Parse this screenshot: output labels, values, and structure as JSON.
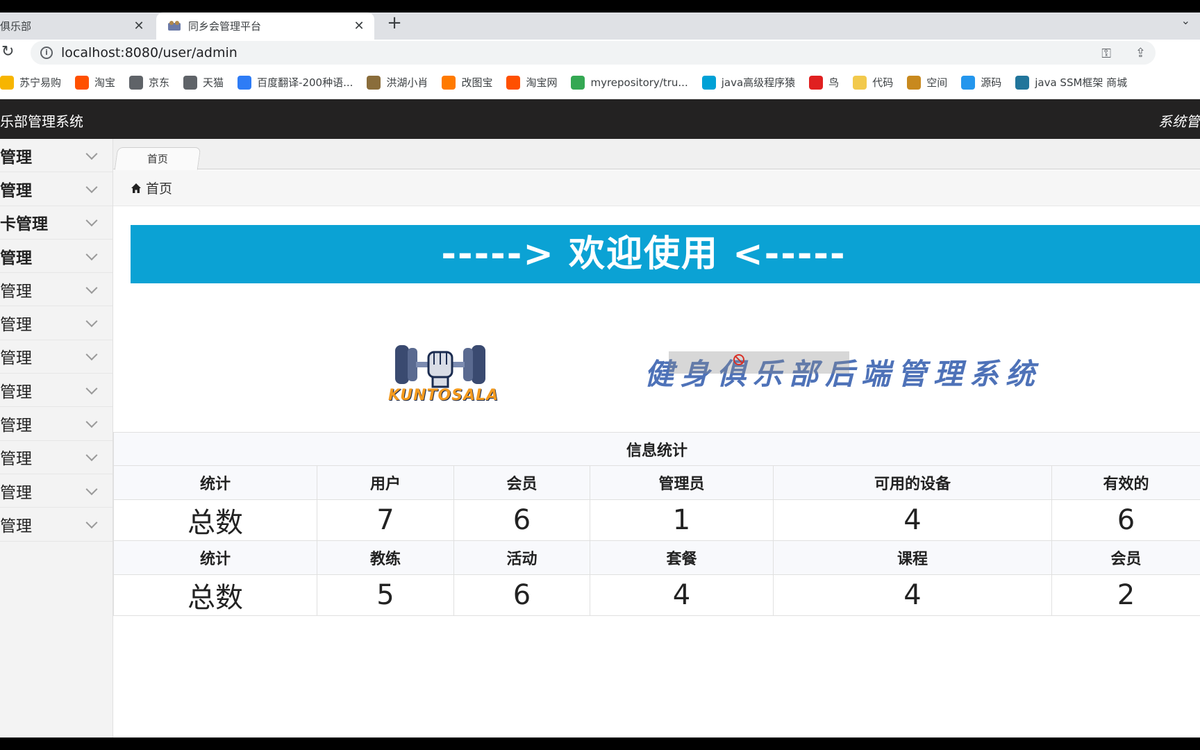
{
  "browser": {
    "tabs": [
      {
        "label": "俱乐部",
        "active": false
      },
      {
        "label": "同乡会管理平台",
        "active": true
      }
    ],
    "new_tab": "+",
    "url": "localhost:8080/user/admin",
    "bookmarks": [
      {
        "label": "苏宁易购",
        "icon": "suning-icon",
        "color": "#f7b500"
      },
      {
        "label": "淘宝",
        "icon": "taobao-icon",
        "color": "#ff5000"
      },
      {
        "label": "京东",
        "icon": "globe-icon",
        "color": "#5f6368"
      },
      {
        "label": "天猫",
        "icon": "globe-icon",
        "color": "#5f6368"
      },
      {
        "label": "百度翻译-200种语...",
        "icon": "baidu-translate-icon",
        "color": "#2e7cf6"
      },
      {
        "label": "洪湖小肖",
        "icon": "bird-icon",
        "color": "#8a6d3b"
      },
      {
        "label": "改图宝",
        "icon": "gaitubao-icon",
        "color": "#ff7a00"
      },
      {
        "label": "淘宝网",
        "icon": "taobao-icon",
        "color": "#ff5000"
      },
      {
        "label": "myrepository/tru...",
        "icon": "chrome-icon",
        "color": "#34a853"
      },
      {
        "label": "java高级程序猿",
        "icon": "bilibili-icon",
        "color": "#00a1d6"
      },
      {
        "label": "鸟",
        "icon": "bird-icon",
        "color": "#e02020"
      },
      {
        "label": "代码",
        "icon": "code-icon",
        "color": "#f2c94c"
      },
      {
        "label": "空间",
        "icon": "space-icon",
        "color": "#c8891e"
      },
      {
        "label": "源码",
        "icon": "docker-icon",
        "color": "#2496ed"
      },
      {
        "label": "java SSM框架 商城",
        "icon": "wordpress-icon",
        "color": "#21759b"
      }
    ]
  },
  "header": {
    "title": "乐部管理系统",
    "right": "系统管"
  },
  "sidebar": {
    "items": [
      {
        "label": "管理",
        "bold": true
      },
      {
        "label": "管理",
        "bold": true
      },
      {
        "label": "卡管理",
        "bold": true
      },
      {
        "label": "管理",
        "bold": true
      },
      {
        "label": "管理",
        "bold": false
      },
      {
        "label": "管理",
        "bold": false
      },
      {
        "label": "管理",
        "bold": false
      },
      {
        "label": "管理",
        "bold": false
      },
      {
        "label": "管理",
        "bold": false
      },
      {
        "label": "管理",
        "bold": false
      },
      {
        "label": "管理",
        "bold": false
      },
      {
        "label": "管理",
        "bold": false
      }
    ]
  },
  "main": {
    "tab": "首页",
    "breadcrumb": "首页",
    "banner": "-----> 欢迎使用 <-----",
    "logo_text": "KUNTOSALA",
    "system_name": "健身俱乐部后端管理系统",
    "stats": {
      "title": "信息统计",
      "rows": [
        {
          "headers": [
            "统计",
            "用户",
            "会员",
            "管理员",
            "可用的设备",
            "有效的"
          ],
          "values": [
            "总数",
            "7",
            "6",
            "1",
            "4",
            "6"
          ]
        },
        {
          "headers": [
            "统计",
            "教练",
            "活动",
            "套餐",
            "课程",
            "会员"
          ],
          "values": [
            "总数",
            "5",
            "6",
            "4",
            "4",
            "2"
          ]
        }
      ]
    }
  },
  "colors": {
    "banner": "#0ba2d4",
    "header": "#232222",
    "system_name": "#4e72b8",
    "logo_text": "#f39a1e"
  }
}
